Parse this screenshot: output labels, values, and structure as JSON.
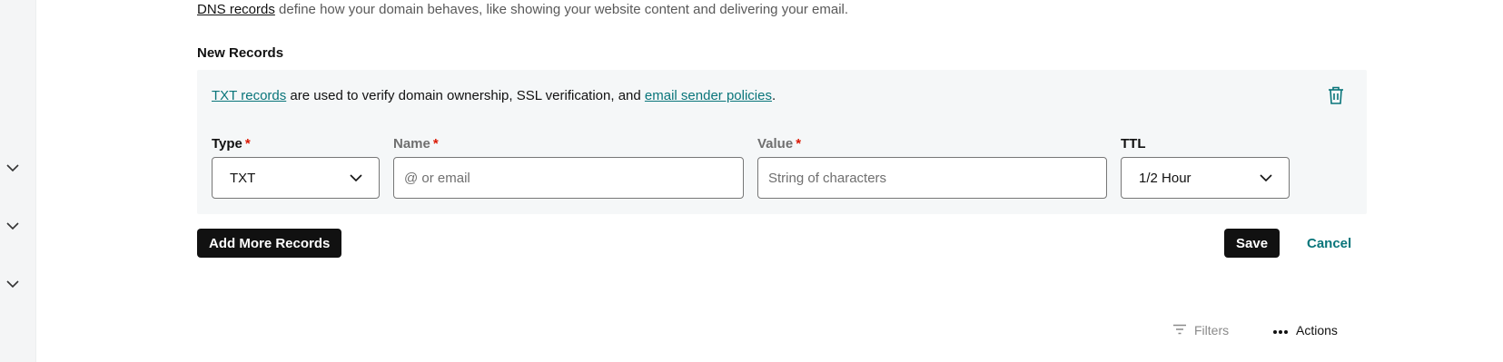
{
  "intro": {
    "link_text": "DNS records",
    "text": " define how your domain behaves, like showing your website content and delivering your email."
  },
  "section_title": "New Records",
  "record_panel": {
    "info_link1": "TXT records",
    "info_text1": " are used to verify domain ownership, SSL verification, and ",
    "info_link2": "email sender policies",
    "info_text2": ".",
    "trash_icon": "trash-icon",
    "fields": {
      "type": {
        "label": "Type",
        "required_mark": "*",
        "value": "TXT"
      },
      "name": {
        "label": "Name",
        "required_mark": "*",
        "placeholder": "@ or email",
        "value": ""
      },
      "value": {
        "label": "Value",
        "required_mark": "*",
        "placeholder": "String of characters",
        "value": ""
      },
      "ttl": {
        "label": "TTL",
        "value": "1/2 Hour"
      }
    }
  },
  "buttons": {
    "add_more": "Add More Records",
    "save": "Save",
    "cancel": "Cancel"
  },
  "toolbar": {
    "filters_label": "Filters",
    "filters_icon": "filter-icon",
    "actions_label": "Actions",
    "actions_icon": "more-horizontal-icon"
  },
  "left_rail": {
    "chevrons": [
      "chevron-down-icon",
      "chevron-down-icon",
      "chevron-down-icon"
    ]
  },
  "colors": {
    "accent": "#09757a",
    "required": "#db1802",
    "panel_bg": "#f5f7f8",
    "dark_button": "#111111"
  }
}
